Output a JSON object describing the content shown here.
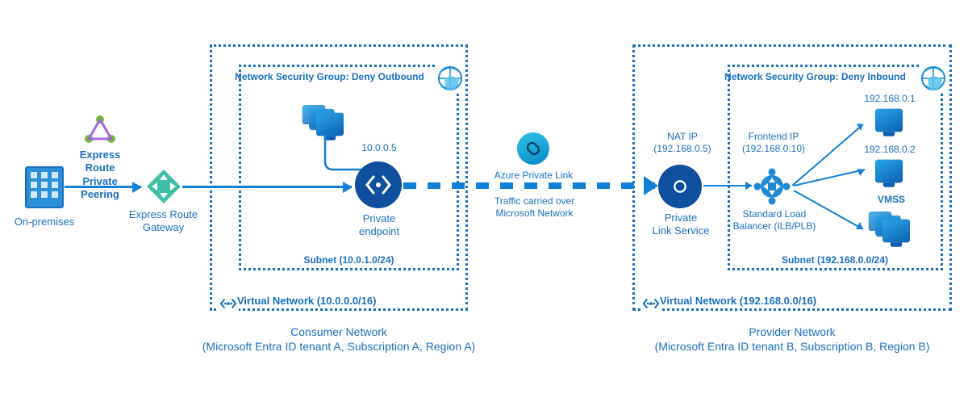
{
  "onprem": {
    "label": "On-premises"
  },
  "express_peering": {
    "label": "Express Route\nPrivate\nPeering"
  },
  "express_gw": {
    "label": "Express Route\nGateway"
  },
  "consumer": {
    "vnet_label": "Virtual Network (10.0.0.0/16)",
    "subnet_label": "Subnet (10.0.1.0/24)",
    "nsg_label": "Network Security Group: Deny Outbound",
    "pe_label": "Private\nendpoint",
    "pe_ip": "10.0.0.5",
    "footer": "Consumer Network\n(Microsoft Entra ID tenant A, Subscription A, Region A)"
  },
  "private_link": {
    "name": "Azure Private Link",
    "caption": "Traffic carried over\nMicrosoft Network"
  },
  "nat_ip": {
    "label": "NAT IP\n(192.168.0.5)"
  },
  "frontend_ip": {
    "label": "Frontend IP\n(192.168.0.10)"
  },
  "provider": {
    "vnet_label": "Virtual Network (192.168.0.0/16)",
    "subnet_label": "Subnet (192.168.0.0/24)",
    "nsg_label": "Network Security Group: Deny Inbound",
    "pls_label": "Private\nLink Service",
    "lb_label": "Standard Load\nBalancer (ILB/PLB)",
    "vm1_ip": "192.168.0.1",
    "vm2_ip": "192.168.0.2",
    "vmss_label": "VMSS",
    "footer": "Provider Network\n(Microsoft Entra ID tenant B, Subscription B, Region B)"
  }
}
